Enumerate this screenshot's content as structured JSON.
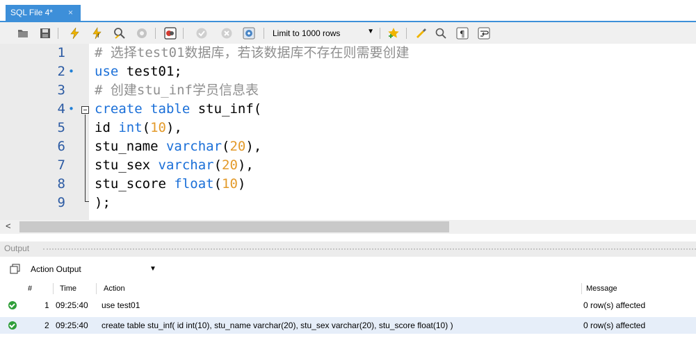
{
  "tab": {
    "title": "SQL File 4*",
    "close": "×"
  },
  "toolbar": {
    "limit_label": "Limit to 1000 rows",
    "colors": {
      "accent": "#3d8fd9",
      "lightning": "#f0b400"
    }
  },
  "editor": {
    "lines": [
      {
        "num": "1",
        "marker": "",
        "segments": [
          {
            "t": "# 选择test01数据库，若该数据库不存在则需要创建",
            "c": "cmt"
          }
        ]
      },
      {
        "num": "2",
        "marker": "•",
        "segments": [
          {
            "t": "use",
            "c": "kw"
          },
          {
            "t": " test01;",
            "c": ""
          }
        ]
      },
      {
        "num": "3",
        "marker": "",
        "segments": [
          {
            "t": "# 创建stu_inf学员信息表",
            "c": "cmt"
          }
        ]
      },
      {
        "num": "4",
        "marker": "•",
        "segments": [
          {
            "t": "create table",
            "c": "kw"
          },
          {
            "t": " stu_inf(",
            "c": ""
          }
        ]
      },
      {
        "num": "5",
        "marker": "",
        "segments": [
          {
            "t": "id ",
            "c": ""
          },
          {
            "t": "int",
            "c": "kw"
          },
          {
            "t": "(",
            "c": ""
          },
          {
            "t": "10",
            "c": "num"
          },
          {
            "t": "),",
            "c": ""
          }
        ]
      },
      {
        "num": "6",
        "marker": "",
        "segments": [
          {
            "t": "stu_name ",
            "c": ""
          },
          {
            "t": "varchar",
            "c": "kw"
          },
          {
            "t": "(",
            "c": ""
          },
          {
            "t": "20",
            "c": "num"
          },
          {
            "t": "),",
            "c": ""
          }
        ]
      },
      {
        "num": "7",
        "marker": "",
        "segments": [
          {
            "t": "stu_sex ",
            "c": ""
          },
          {
            "t": "varchar",
            "c": "kw"
          },
          {
            "t": "(",
            "c": ""
          },
          {
            "t": "20",
            "c": "num"
          },
          {
            "t": "),",
            "c": ""
          }
        ]
      },
      {
        "num": "8",
        "marker": "",
        "segments": [
          {
            "t": "stu_score ",
            "c": ""
          },
          {
            "t": "float",
            "c": "kw"
          },
          {
            "t": "(",
            "c": ""
          },
          {
            "t": "10",
            "c": "num"
          },
          {
            "t": ")",
            "c": ""
          }
        ]
      },
      {
        "num": "9",
        "marker": "",
        "segments": [
          {
            "t": ");",
            "c": ""
          }
        ]
      }
    ]
  },
  "output": {
    "title": "Output",
    "selector": "Action Output",
    "columns": {
      "hash": "#",
      "time": "Time",
      "action": "Action",
      "message": "Message"
    },
    "rows": [
      {
        "n": "1",
        "time": "09:25:40",
        "action": "use test01",
        "message": "0 row(s) affected"
      },
      {
        "n": "2",
        "time": "09:25:40",
        "action": "create table stu_inf( id int(10), stu_name varchar(20), stu_sex varchar(20), stu_score float(10) )",
        "message": "0 row(s) affected"
      }
    ]
  }
}
